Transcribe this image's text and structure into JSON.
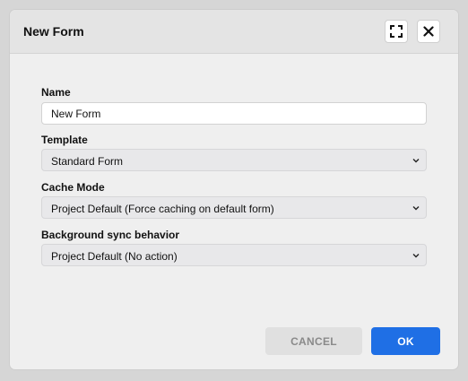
{
  "dialog": {
    "title": "New Form",
    "expand_icon": "expand-icon",
    "close_icon": "close-icon"
  },
  "form": {
    "name": {
      "label": "Name",
      "value": "New Form"
    },
    "template": {
      "label": "Template",
      "value": "Standard Form"
    },
    "cache_mode": {
      "label": "Cache Mode",
      "value": "Project Default (Force caching on default form)"
    },
    "background_sync": {
      "label": "Background sync behavior",
      "value": "Project Default (No action)"
    }
  },
  "footer": {
    "cancel_label": "CANCEL",
    "ok_label": "OK"
  },
  "colors": {
    "primary": "#1f6fe5",
    "cancel_bg": "#e0e0e0",
    "dialog_bg": "#efefef",
    "header_bg": "#e4e4e4"
  }
}
